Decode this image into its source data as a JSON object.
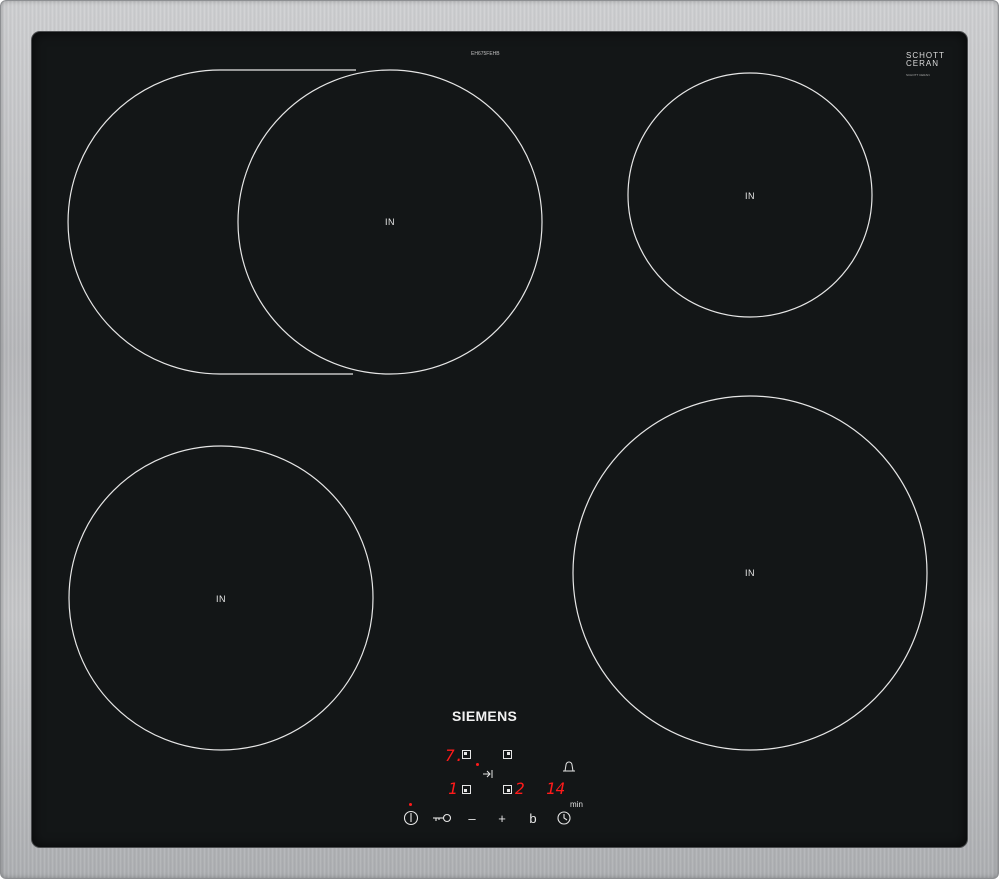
{
  "brand": "SIEMENS",
  "glass_brand": {
    "line1": "SCHOTT",
    "line2": "CERAN",
    "sub": "SCHOTT CERAN"
  },
  "top_small_text": "EH675FEHB",
  "zones": [
    {
      "id": "rear-left",
      "label": "IN"
    },
    {
      "id": "rear-right",
      "label": "IN"
    },
    {
      "id": "front-left",
      "label": "IN"
    },
    {
      "id": "front-right",
      "label": "IN"
    }
  ],
  "displays": {
    "zone_top": "7.",
    "zone_bottom": "1",
    "zone_right": "2",
    "timer": "14",
    "timer_unit": "min"
  },
  "controls": {
    "power_icon": "power-icon",
    "lock_icon": "key-lock-icon",
    "minus": "–",
    "plus": "+",
    "boost": "b",
    "clock_icon": "clock-icon",
    "bell_icon": "bell-icon",
    "arrow_icon": "arrow-to-bar-icon"
  },
  "colors": {
    "glass": "#131617",
    "display": "#ff1a1a",
    "frame": "#bfc0c2",
    "lines": "#e6e6e6"
  }
}
